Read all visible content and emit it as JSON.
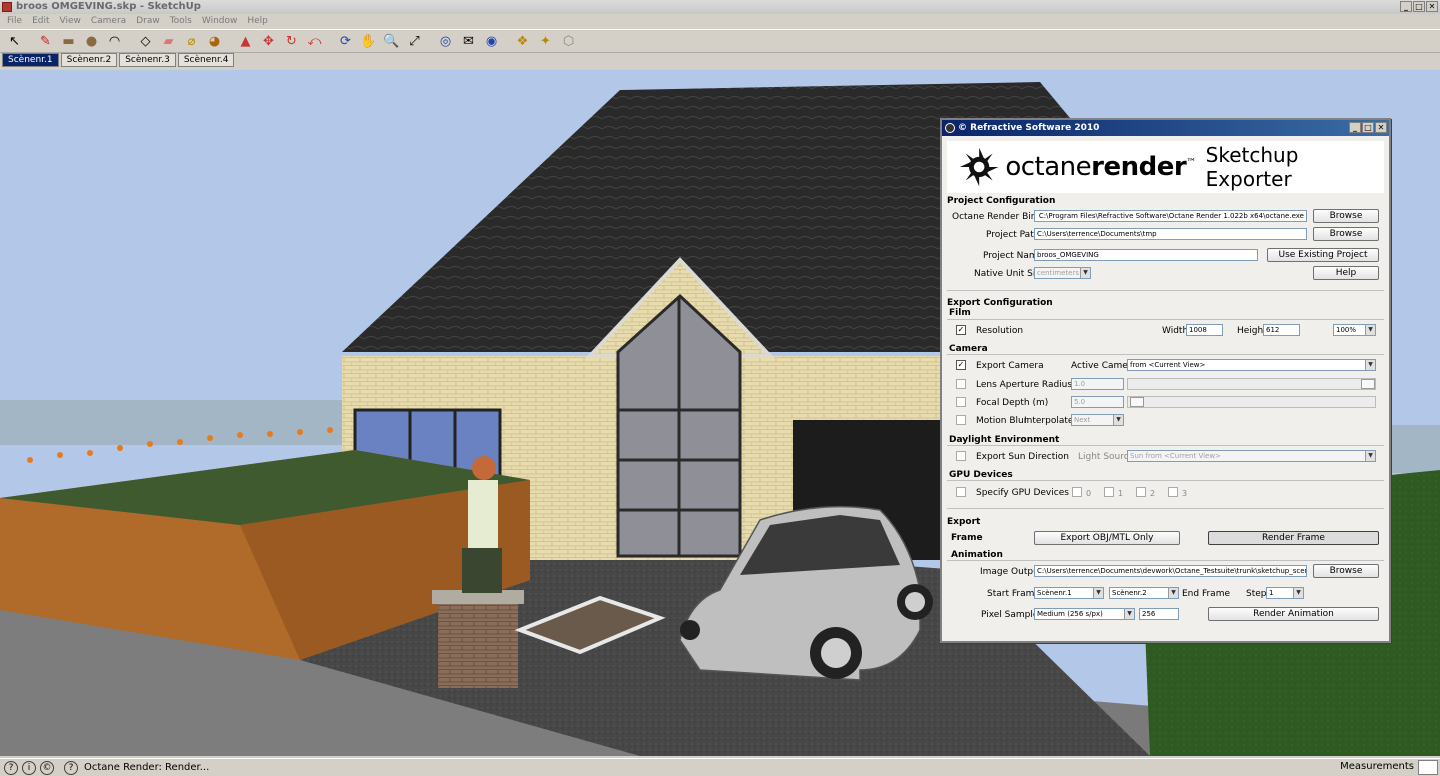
{
  "window": {
    "title": "broos OMGEVING.skp - SketchUp",
    "min": "_",
    "max": "□",
    "close": "✕"
  },
  "menu": [
    "File",
    "Edit",
    "View",
    "Camera",
    "Draw",
    "Tools",
    "Window",
    "Help"
  ],
  "toolbar": [
    {
      "icon": "select-arrow-icon",
      "glyph": "↖"
    },
    {
      "icon": "pencil-icon",
      "glyph": "✎"
    },
    {
      "icon": "rectangle-icon",
      "glyph": "▬"
    },
    {
      "icon": "circle-icon",
      "glyph": "●"
    },
    {
      "icon": "arc-icon",
      "glyph": "◠"
    },
    {
      "icon": "make-component-icon",
      "glyph": "◇"
    },
    {
      "icon": "eraser-icon",
      "glyph": "▰"
    },
    {
      "icon": "tape-measure-icon",
      "glyph": "⌀"
    },
    {
      "icon": "paint-bucket-icon",
      "glyph": "◕"
    },
    {
      "icon": "push-pull-icon",
      "glyph": "▲"
    },
    {
      "icon": "move-icon",
      "glyph": "✥"
    },
    {
      "icon": "rotate-icon",
      "glyph": "↻"
    },
    {
      "icon": "offset-icon",
      "glyph": "⤺"
    },
    {
      "icon": "orbit-icon",
      "glyph": "⟳"
    },
    {
      "icon": "pan-icon",
      "glyph": "✋"
    },
    {
      "icon": "zoom-icon",
      "glyph": "🔍"
    },
    {
      "icon": "zoom-extents-icon",
      "glyph": "⤢"
    },
    {
      "icon": "get-models-icon",
      "glyph": "◎"
    },
    {
      "icon": "share-model-icon",
      "glyph": "✉"
    },
    {
      "icon": "share-component-icon",
      "glyph": "◉"
    },
    {
      "icon": "get-components-icon",
      "glyph": "❖"
    },
    {
      "icon": "extension-icon",
      "glyph": "✦"
    },
    {
      "icon": "octane-icon",
      "glyph": "⬡"
    }
  ],
  "scene_tabs": [
    "Scènenr.1",
    "Scènenr.2",
    "Scènenr.3",
    "Scènenr.4"
  ],
  "status": {
    "text": "Octane Render: Render...",
    "measurements_label": "Measurements"
  },
  "dialog": {
    "title": "© Refractive Software 2010",
    "brand_light": "octane",
    "brand_bold": "render",
    "brand_tm": "™",
    "brand_tag": "Sketchup Exporter",
    "project_configuration": "Project Configuration",
    "octane_binary_label": "Octane Render Binary",
    "octane_binary_value": "C:\\Program Files\\Refractive Software\\Octane Render 1.022b x64\\octane.exe",
    "project_path_label": "Project Path",
    "project_path_value": "C:\\Users\\terrence\\Documents\\tmp",
    "project_name_label": "Project Name",
    "project_name_value": "broos_OMGEVING",
    "native_unit_label": "Native Unit Size",
    "native_unit_value": "centimeters",
    "browse": "Browse",
    "use_existing": "Use Existing Project",
    "help": "Help",
    "export_configuration": "Export Configuration",
    "film": "Film",
    "resolution_label": "Resolution",
    "width_label": "Width",
    "width_value": "1008",
    "height_label": "Height",
    "height_value": "612",
    "zoom_value": "100%",
    "camera": "Camera",
    "export_camera": "Export Camera",
    "active_camera_label": "Active Camera",
    "active_camera_value": "from <Current View>",
    "lens_aperture": "Lens Aperture Radius",
    "lens_aperture_value": "1.0",
    "focal_depth": "Focal Depth (m)",
    "focal_depth_value": "5.0",
    "motion_blur": "Motion Blur",
    "interpolate_label": "Interpolate",
    "interpolate_value": "Next",
    "daylight_environment": "Daylight Environment",
    "export_sun": "Export Sun Direction",
    "light_source_label": "Light Source",
    "light_source_value": "Sun from <Current View>",
    "gpu_devices": "GPU Devices",
    "specify_gpu": "Specify GPU Devices",
    "gpu": [
      "0",
      "1",
      "2",
      "3"
    ],
    "export": "Export",
    "frame": "Frame",
    "export_obj": "Export OBJ/MTL Only",
    "render_frame": "Render Frame",
    "animation": "Animation",
    "image_output_label": "Image Output",
    "image_output_value": "C:\\Users\\terrence\\Documents\\devwork\\Octane_Testsuite\\trunk\\sketchup_scenes\\img00",
    "start_frame_label": "Start Frame",
    "start_frame_value": "Scènenr.1",
    "end_frame_value": "Scènenr.2",
    "end_frame_label": "End Frame",
    "step_label": "Step",
    "step_value": "1",
    "pixel_samples_label": "Pixel Samples",
    "pixel_samples_value": "Medium (256 s/px)",
    "pixel_samples_number": "256",
    "render_animation": "Render Animation",
    "check": "✓",
    "dropdown": "▼"
  }
}
